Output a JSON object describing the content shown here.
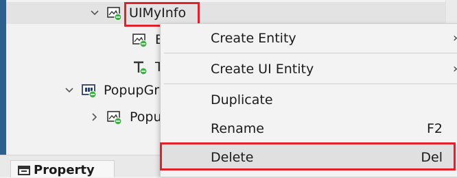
{
  "hierarchy": {
    "nodes": [
      {
        "label": "UIMyInfo",
        "icon": "image-entity-icon",
        "expander": "expanded"
      },
      {
        "label": "B",
        "icon": "image-entity-icon",
        "expander": "none"
      },
      {
        "label": "T",
        "icon": "text-entity-icon",
        "expander": "none"
      },
      {
        "label": "PopupGr",
        "icon": "popup-group-icon",
        "expander": "expanded"
      },
      {
        "label": "Popu",
        "icon": "image-entity-icon",
        "expander": "collapsed"
      }
    ]
  },
  "bottom_tab": {
    "label": "Property",
    "icon": "property-panel-icon"
  },
  "context_menu": {
    "items": [
      {
        "label": "Create Entity",
        "shortcut": "",
        "submenu": true
      },
      {
        "label": "Create UI Entity",
        "shortcut": "",
        "submenu": true
      },
      {
        "label": "Duplicate",
        "shortcut": ""
      },
      {
        "label": "Rename",
        "shortcut": "F2"
      },
      {
        "label": "Delete",
        "shortcut": "Del"
      }
    ],
    "submenu_arrow": "›"
  },
  "colors": {
    "highlight": "#e0202a",
    "status_badge": "#3cb043",
    "window_accent": "#2f5f8f"
  }
}
